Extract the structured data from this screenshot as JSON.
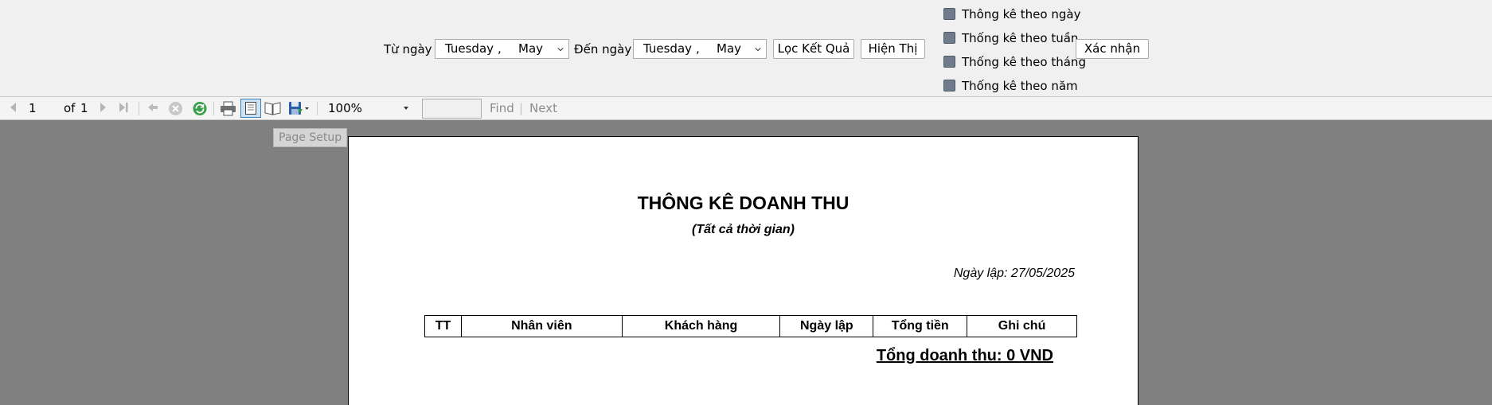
{
  "filter": {
    "from_label": "Từ ngày",
    "from_date": {
      "day": "Tuesday",
      "comma": ",",
      "month": "May"
    },
    "to_label": "Đến ngày",
    "to_date": {
      "day": "Tuesday",
      "comma": ",",
      "month": "May"
    },
    "filter_button": "Lọc Kết Quả",
    "show_button": "Hiện Thị",
    "confirm_button": "Xác nhận",
    "checkboxes": [
      {
        "label": "Thông kê theo ngày",
        "checked": false
      },
      {
        "label": "Thống kê theo tuần",
        "checked": false
      },
      {
        "label": "Thống kê theo tháng",
        "checked": false
      },
      {
        "label": "Thống kê theo năm",
        "checked": false
      }
    ]
  },
  "toolbar": {
    "current_page": "1",
    "of_label": "of",
    "total_pages": "1",
    "zoom": "100%",
    "find_value": "",
    "find_label": "Find",
    "find_separator": "|",
    "next_label": "Next",
    "tooltip": "Page Setup",
    "icons": [
      "first-page-icon",
      "prev-page-icon",
      "next-page-icon",
      "last-page-icon",
      "back-icon",
      "stop-icon",
      "refresh-icon",
      "print-icon",
      "print-layout-icon",
      "page-setup-icon",
      "export-icon"
    ]
  },
  "report": {
    "title": "THÔNG KÊ DOANH THU",
    "subtitle": "(Tất cả thời gian)",
    "date_line": "Ngày lập: 27/05/2025",
    "columns": [
      "TT",
      "Nhân viên",
      "Khách hàng",
      "Ngày lập",
      "Tổng tiền",
      "Ghi chú"
    ],
    "total_line": "Tổng doanh thu: 0 VND"
  }
}
